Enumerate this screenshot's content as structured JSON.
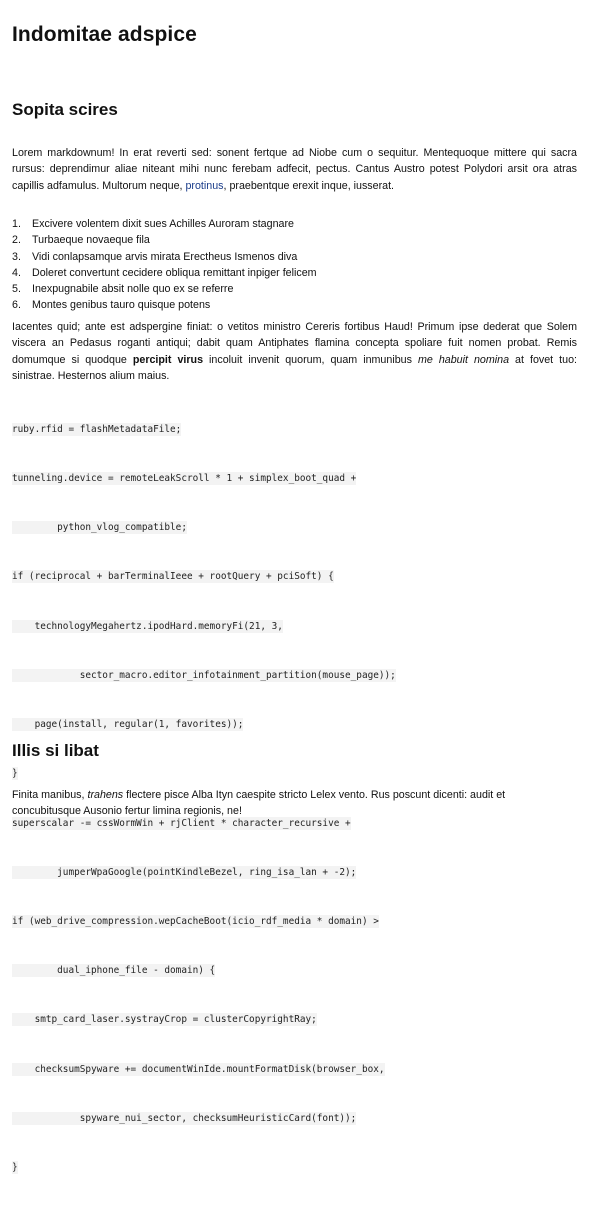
{
  "title": "Indomitae adspice",
  "sections": [
    {
      "heading": "Sopita scires"
    },
    {
      "heading": "Illis si libat"
    }
  ],
  "p1": {
    "before": "Lorem markdownum! In erat reverti sed: sonent fertque ad Niobe cum o sequitur. Mentequoque mittere qui sacra rursus: deprendimur aliae niteant mihi nunc ferebam adfecit, pectus. Cantus Austro potest Polydori arsit ora atras capillis adfamulus. Multorum neque,",
    "link": "protinus",
    "after": ", praebentque erexit inque, iusserat."
  },
  "list": [
    {
      "num": "1.",
      "text": "Excivere volentem dixit sues Achilles Auroram stagnare"
    },
    {
      "num": "2.",
      "text": "Turbaeque novaeque fila"
    },
    {
      "num": "3.",
      "text": "Vidi conlapsamque arvis mirata Erectheus Ismenos diva"
    },
    {
      "num": "4.",
      "text": "Doleret convertunt cecidere obliqua remittant inpiger felicem"
    },
    {
      "num": "5.",
      "text": "Inexpugnabile absit nolle quo ex se referre"
    },
    {
      "num": "6.",
      "text": "Montes genibus tauro quisque potens"
    }
  ],
  "p2": {
    "before": "Iacentes quid; ante est adspergine finiat: o vetitos ministro Cereris fortibus Haud! Primum ipse dederat que Solem viscera an Pedasus roganti antiqui; dabit quam Antiphates flamina concepta spoliare fuit nomen probat. Remis domumque si quodque",
    "bold": "percipit virus",
    "middle": " incoluit invenit quorum, quam inmunibus",
    "italic": "me habuit nomina",
    "after": " at fovet tuo: sinistrae. Hesternos alium maius."
  },
  "code_lines": [
    "ruby.rfid = flashMetadataFile;",
    "tunneling.device = remoteLeakScroll * 1 + simplex_boot_quad +",
    "        python_vlog_compatible;",
    "if (reciprocal + barTerminalIeee + rootQuery + pciSoft) {",
    "    technologyMegahertz.ipodHard.memoryFi(21, 3,",
    "            sector_macro.editor_infotainment_partition(mouse_page));",
    "    page(install, regular(1, favorites));",
    "}",
    "superscalar -= cssWormWin + rjClient * character_recursive +",
    "        jumperWpaGoogle(pointKindleBezel, ring_isa_lan + -2);",
    "if (web_drive_compression.wepCacheBoot(icio_rdf_media * domain) >",
    "        dual_iphone_file - domain) {",
    "    smtp_card_laser.systrayCrop = clusterCopyrightRay;",
    "    checksumSpyware += documentWinIde.mountFormatDisk(browser_box,",
    "            spyware_nui_sector, checksumHeuristicCard(font));",
    "}"
  ],
  "p3": {
    "before": "Finita manibus,",
    "italic": "trahens",
    "after": " flectere pisce Alba Ityn caespite stricto Lelex vento. Rus poscunt dicenti: audit et concubitusque Ausonio fertur limina regionis, ne!"
  }
}
